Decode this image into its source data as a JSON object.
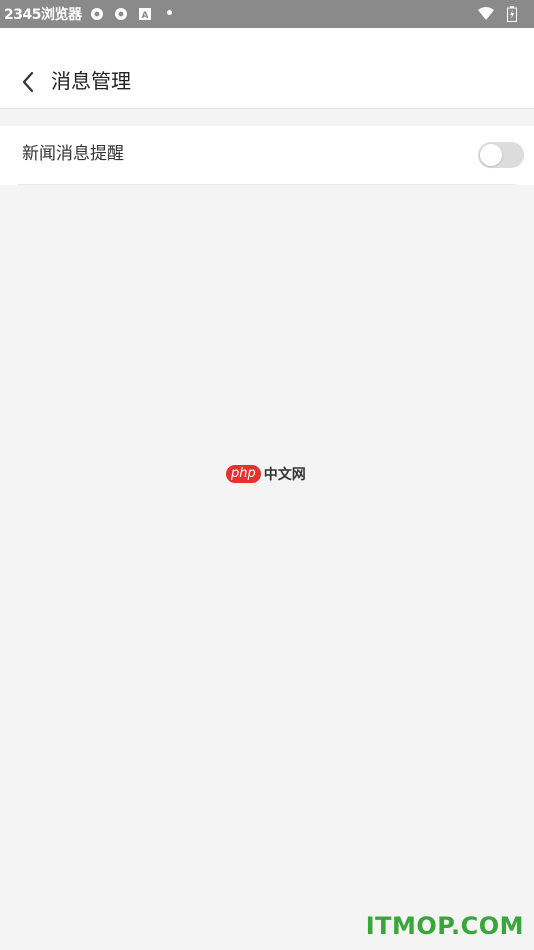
{
  "status_bar": {
    "title": "2345浏览器",
    "dot": "•",
    "icons": [
      "settings-icon",
      "settings-icon",
      "a-box-icon",
      "dot-icon",
      "wifi-icon",
      "battery-icon"
    ]
  },
  "header": {
    "title": "消息管理",
    "back_icon": "chevron-left-icon"
  },
  "settings": {
    "items": [
      {
        "label": "新闻消息提醒",
        "enabled": false
      }
    ]
  },
  "watermarks": {
    "php_badge": "php",
    "php_text": "中文网",
    "itmop": "ITMOP.COM"
  },
  "colors": {
    "status_bar_bg": "#8a8a8a",
    "page_bg": "#f4f4f4",
    "toggle_off": "#dcdcdc",
    "php_red": "#e8312f",
    "itmop_green": "#3aa53a"
  }
}
